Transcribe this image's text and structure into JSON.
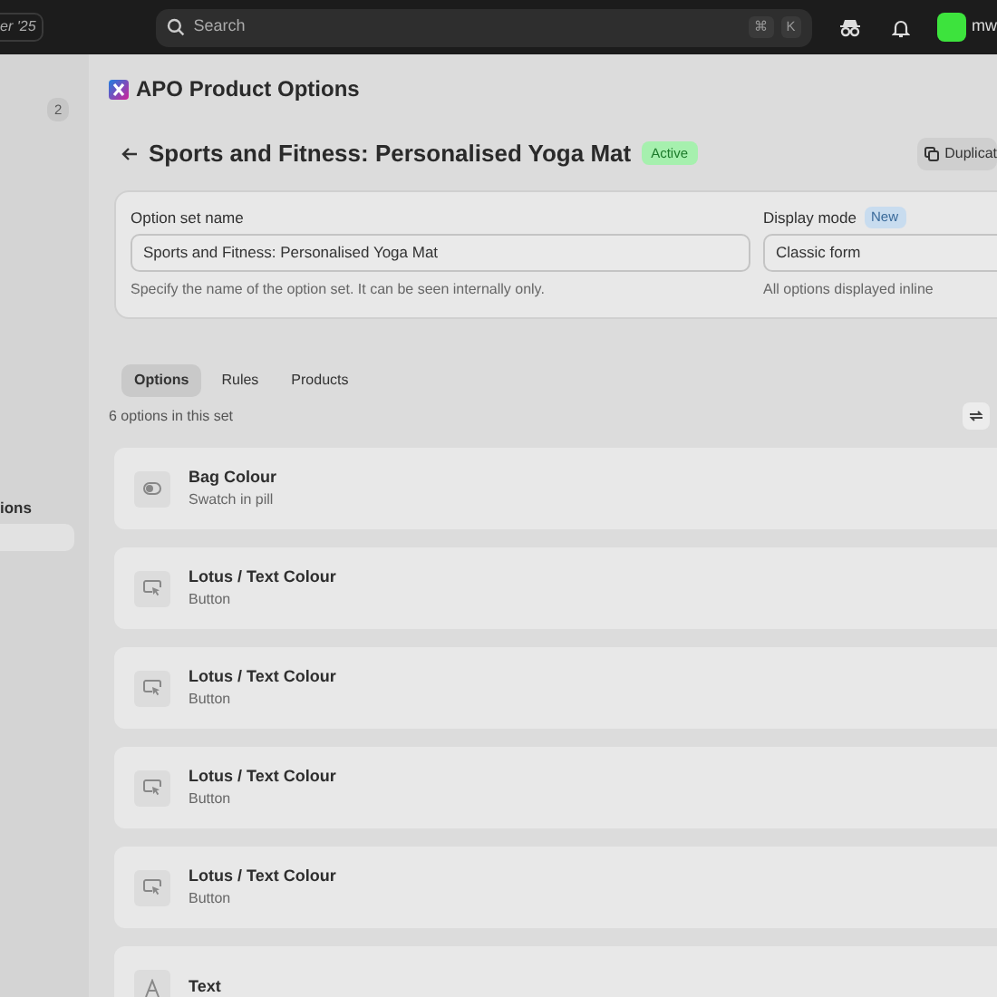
{
  "topbar": {
    "left_label": "er '25",
    "search": {
      "placeholder": "Search"
    },
    "shortcut_keys": [
      "⌘",
      "K"
    ],
    "user_initials": "mw"
  },
  "sidebar": {
    "badge": "2",
    "section_label": "ions",
    "items": [
      {
        "selected": true
      }
    ]
  },
  "app_title": "APO Product Options",
  "header": {
    "title": "Sports and Fitness: Personalised Yoga Mat",
    "status": "Active",
    "action": "Duplicat"
  },
  "settings": {
    "name": {
      "label": "Option set name",
      "value": "Sports and Fitness: Personalised Yoga Mat",
      "help": "Specify the name of the option set. It can be seen internally only."
    },
    "display_mode": {
      "label": "Display mode",
      "badge": "New",
      "value": "Classic form",
      "help": "All options displayed inline"
    }
  },
  "tabs": [
    {
      "label": "Options",
      "selected": true
    },
    {
      "label": "Rules",
      "selected": false
    },
    {
      "label": "Products",
      "selected": false
    }
  ],
  "options_count": "6 options in this set",
  "options": [
    {
      "kind": "swatch",
      "title": "Bag Colour",
      "subtitle": "Swatch in pill"
    },
    {
      "kind": "button",
      "title": "Lotus / Text Colour",
      "subtitle": "Button"
    },
    {
      "kind": "button",
      "title": "Lotus / Text Colour",
      "subtitle": "Button"
    },
    {
      "kind": "button",
      "title": "Lotus / Text Colour",
      "subtitle": "Button"
    },
    {
      "kind": "button",
      "title": "Lotus / Text Colour",
      "subtitle": "Button"
    },
    {
      "kind": "text",
      "title": "Text"
    }
  ]
}
